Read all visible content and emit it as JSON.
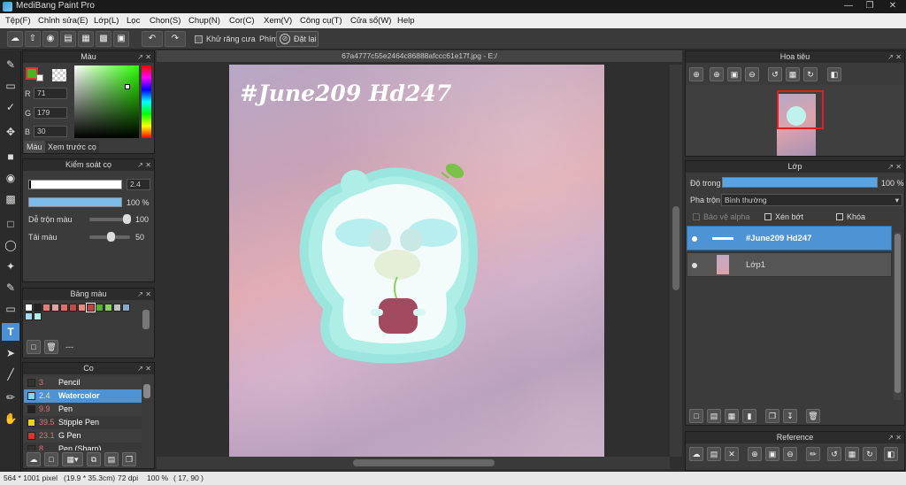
{
  "app": {
    "title": "MediBang Paint Pro"
  },
  "menu": [
    "Tệp(F)",
    "Chỉnh sửa(E)",
    "Lớp(L)",
    "Lọc",
    "Chọn(S)",
    "Chụp(N)",
    "Cor(C)",
    "Xem(V)",
    "Công cụ(T)",
    "Cửa sổ(W)",
    "Help"
  ],
  "toolbar": {
    "antialias_label": "Khử răng cưa",
    "snap_label": "Phím",
    "reset_label": "Đặt lại"
  },
  "color_panel": {
    "title": "Màu",
    "r": "71",
    "g": "179",
    "b": "30",
    "r_label": "R",
    "g_label": "G",
    "b_label": "B",
    "tab_color": "Màu",
    "tab_preview": "Xem trước cọ",
    "primary_color": "#47b31e"
  },
  "brush_control": {
    "title": "Kiểm soát cọ",
    "size": "2.4",
    "opacity": "100 %",
    "blend_label": "Dễ trộn màu",
    "blend_value": "100",
    "reload_label": "Tải màu",
    "reload_value": "50"
  },
  "palette_panel": {
    "title": "Bảng màu",
    "colors": [
      "#ffffff",
      "#222222",
      "#e87a7a",
      "#e8a0a0",
      "#e86b6b",
      "#c84848",
      "#f08a80",
      "#c84040",
      "#58b030",
      "#88d060",
      "#c0c0c0",
      "#88a8c8",
      "#a8d8f0",
      "#b0f0e8"
    ],
    "empty_label": "---"
  },
  "brush_panel": {
    "title": "Co",
    "items": [
      {
        "size": "3",
        "name": "Pencil",
        "color": "#333333",
        "selected": false
      },
      {
        "size": "2.4",
        "name": "Watercolor",
        "color": "#7fd8ee",
        "selected": true
      },
      {
        "size": "9.9",
        "name": "Pen",
        "color": "#222222",
        "selected": false
      },
      {
        "size": "39.5",
        "name": "Stipple Pen",
        "color": "#f0d020",
        "selected": false
      },
      {
        "size": "23.1",
        "name": "G Pen",
        "color": "#e03030",
        "selected": false
      },
      {
        "size": "8",
        "name": "Pen (Sharp)",
        "color": "#333333",
        "selected": false
      }
    ]
  },
  "canvas": {
    "tab_title": "67a4777c55e2464c86888afccc61e17f.jpg - E:/",
    "artwork_text": "#June209 Hd247"
  },
  "navigator": {
    "title": "Hoa tiêu"
  },
  "layer_panel": {
    "title": "Lớp",
    "opacity_label": "Độ trong",
    "opacity_value": "100 %",
    "blend_label": "Pha trộn",
    "blend_value": "Bình thường",
    "protect_alpha": "Bảo vệ alpha",
    "clipping": "Xén bớt",
    "lock": "Khóa",
    "layers": [
      {
        "name": "#June209 Hd247",
        "selected": true
      },
      {
        "name": "Lớp1",
        "selected": false
      }
    ]
  },
  "reference": {
    "title": "Reference"
  },
  "status": {
    "size": "564 * 1001 pixel",
    "cm": "(19.9 * 35.3cm)",
    "dpi": "72 dpi",
    "zoom": "100 %",
    "coords": "( 17, 90 )"
  }
}
